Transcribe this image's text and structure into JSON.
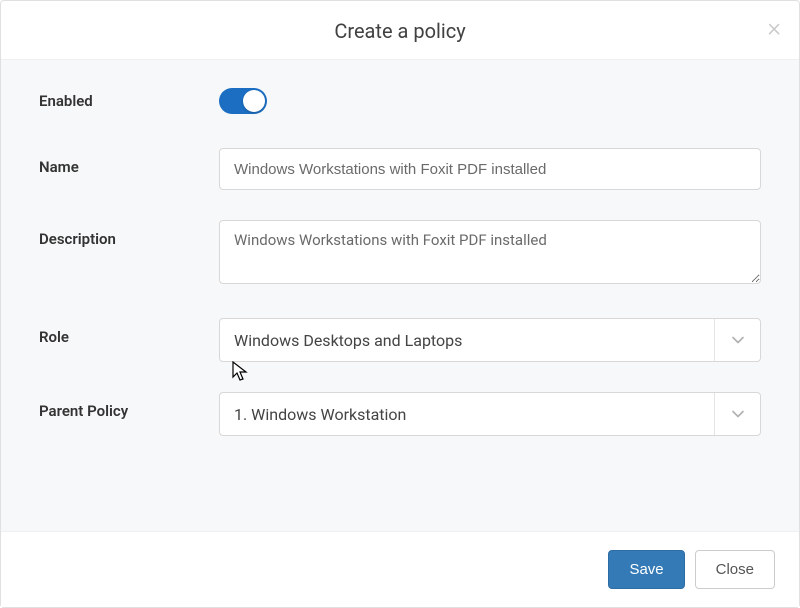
{
  "dialog": {
    "title": "Create a policy"
  },
  "form": {
    "enabled": {
      "label": "Enabled",
      "value": true
    },
    "name": {
      "label": "Name",
      "value": "Windows Workstations with Foxit PDF installed"
    },
    "description": {
      "label": "Description",
      "value": "Windows Workstations with Foxit PDF installed"
    },
    "role": {
      "label": "Role",
      "value": "Windows Desktops and Laptops"
    },
    "parent_policy": {
      "label": "Parent Policy",
      "value": "1. Windows Workstation"
    }
  },
  "footer": {
    "save_label": "Save",
    "close_label": "Close"
  }
}
